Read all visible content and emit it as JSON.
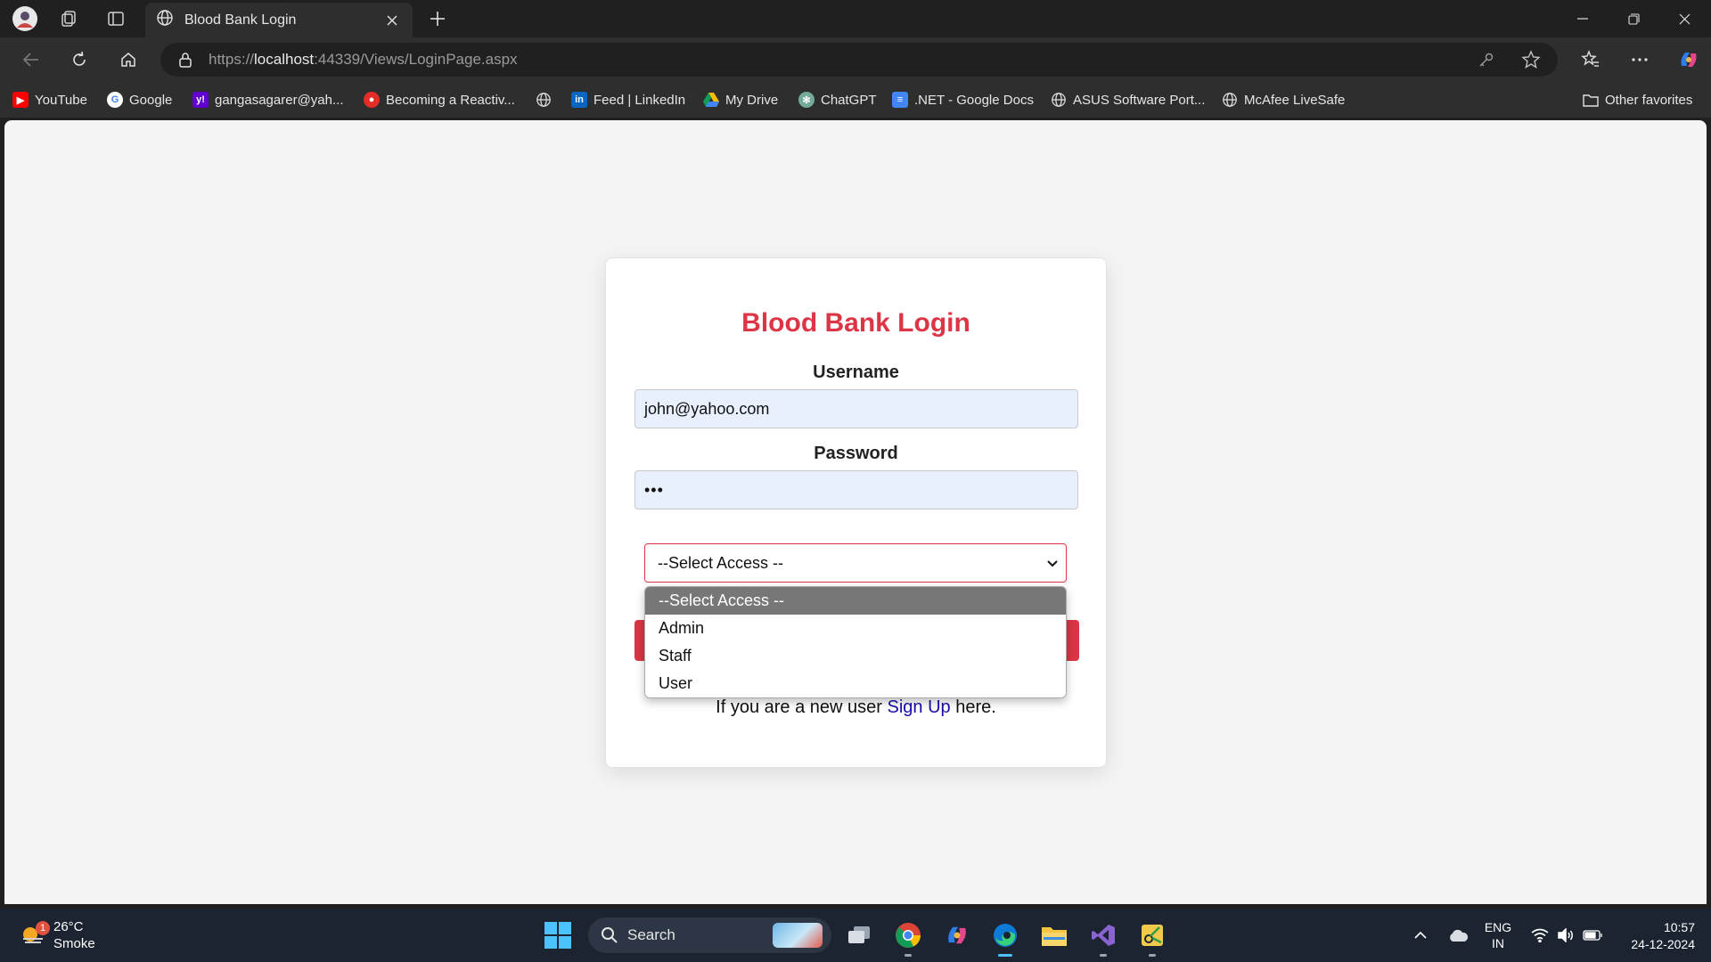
{
  "browser": {
    "tab_title": "Blood Bank Login",
    "url_scheme": "https://",
    "url_host": "localhost",
    "url_rest": ":44339/Views/LoginPage.aspx"
  },
  "bookmarks": [
    {
      "label": "YouTube",
      "icon": "youtube-icon"
    },
    {
      "label": "Google",
      "icon": "google-icon"
    },
    {
      "label": "gangasagarer@yah...",
      "icon": "yahoo-icon"
    },
    {
      "label": "Becoming a Reactiv...",
      "icon": "red-circle-icon"
    },
    {
      "label": "",
      "icon": "globe-icon"
    },
    {
      "label": "Feed | LinkedIn",
      "icon": "linkedin-icon"
    },
    {
      "label": "My Drive",
      "icon": "drive-icon"
    },
    {
      "label": "ChatGPT",
      "icon": "chatgpt-icon"
    },
    {
      "label": ".NET - Google Docs",
      "icon": "docs-icon"
    },
    {
      "label": "ASUS Software Port...",
      "icon": "globe-icon"
    },
    {
      "label": "McAfee LiveSafe",
      "icon": "globe-icon"
    }
  ],
  "other_favorites": "Other favorites",
  "login": {
    "title": "Blood Bank Login",
    "username_label": "Username",
    "username_value": "john@yahoo.com",
    "password_label": "Password",
    "password_value": "•••",
    "select_value": "--Select Access --",
    "options": [
      "--Select Access --",
      "Admin",
      "Staff",
      "User"
    ],
    "signup_prefix": "If you are a new user ",
    "signup_link": "Sign Up",
    "signup_suffix": " here."
  },
  "colors": {
    "accent": "#dc3545",
    "link": "#1a0dab",
    "autofill": "#e8f0fe"
  },
  "taskbar": {
    "weather_temp": "26°C",
    "weather_desc": "Smoke",
    "weather_badge": "1",
    "search_label": "Search",
    "lang_top": "ENG",
    "lang_bottom": "IN",
    "time": "10:57",
    "date": "24-12-2024"
  }
}
